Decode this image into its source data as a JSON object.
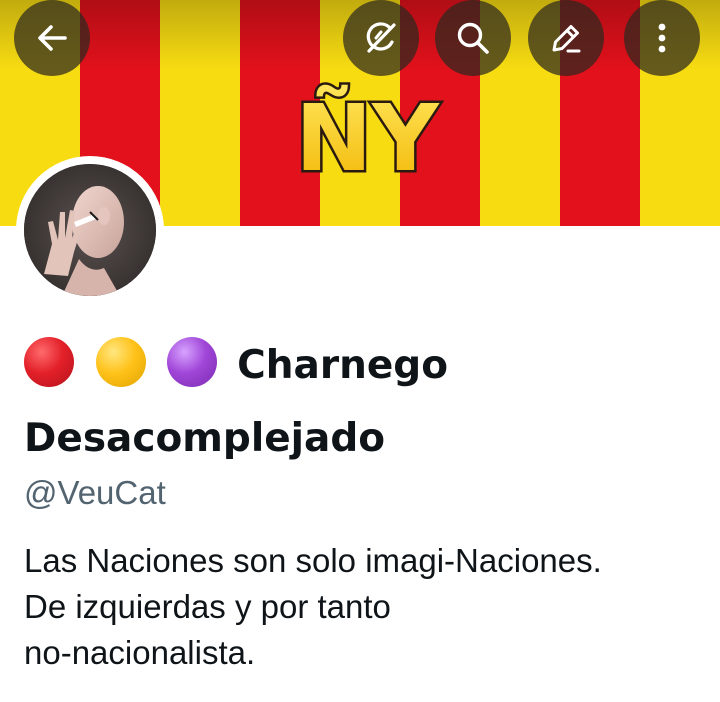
{
  "header": {
    "banner": {
      "logo_text": "ÑY",
      "stripe_colors": [
        "#f8dc12",
        "#e2111b"
      ]
    },
    "buttons": [
      {
        "name": "back",
        "icon": "arrow-left-icon"
      },
      {
        "name": "grok",
        "icon": "grok-icon"
      },
      {
        "name": "search",
        "icon": "search-icon"
      },
      {
        "name": "edit",
        "icon": "pencil-icon"
      },
      {
        "name": "more",
        "icon": "more-vertical-icon"
      }
    ]
  },
  "profile": {
    "emoji_dots": [
      {
        "color": "red",
        "hex": "#e3202a"
      },
      {
        "color": "yellow",
        "hex": "#ffc21a"
      },
      {
        "color": "purple",
        "hex": "#a046d8"
      }
    ],
    "name": "Charnego Desacomplejado",
    "handle": "@VeuCat",
    "bio_lines": [
      "Las Naciones son solo imagi-Naciones.",
      "De izquierdas y por tanto",
      "no-nacionalista."
    ]
  },
  "colors": {
    "text_primary": "#0f1419",
    "text_secondary": "#536471",
    "button_overlay": "rgba(45,40,30,0.72)"
  }
}
